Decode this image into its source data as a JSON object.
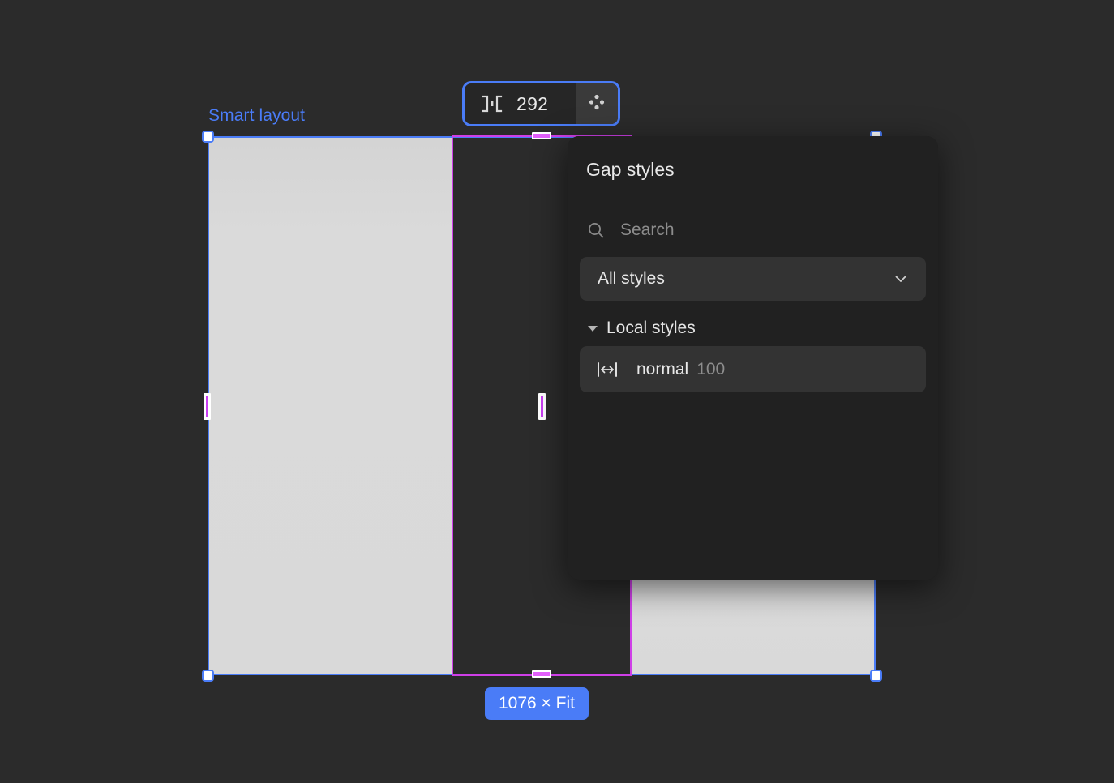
{
  "canvas": {
    "frame": {
      "label": "Smart layout",
      "dimension_badge": "1076 × Fit",
      "accent_color": "#4a7cf7",
      "gap_color": "#cf3fe8"
    }
  },
  "gap_toolbar": {
    "icon": "gap-horizontal-icon",
    "value": "292",
    "drag_icon": "move-dots-icon"
  },
  "styles_panel": {
    "title": "Gap styles",
    "search": {
      "icon": "search-icon",
      "placeholder": "Search",
      "value": ""
    },
    "filter": {
      "label": "All styles",
      "chevron": "chevron-down-icon"
    },
    "groups": [
      {
        "title": "Local styles",
        "expanded": true,
        "items": [
          {
            "icon": "gap-width-icon",
            "name": "normal",
            "value": "100",
            "selected": true
          }
        ]
      }
    ]
  }
}
